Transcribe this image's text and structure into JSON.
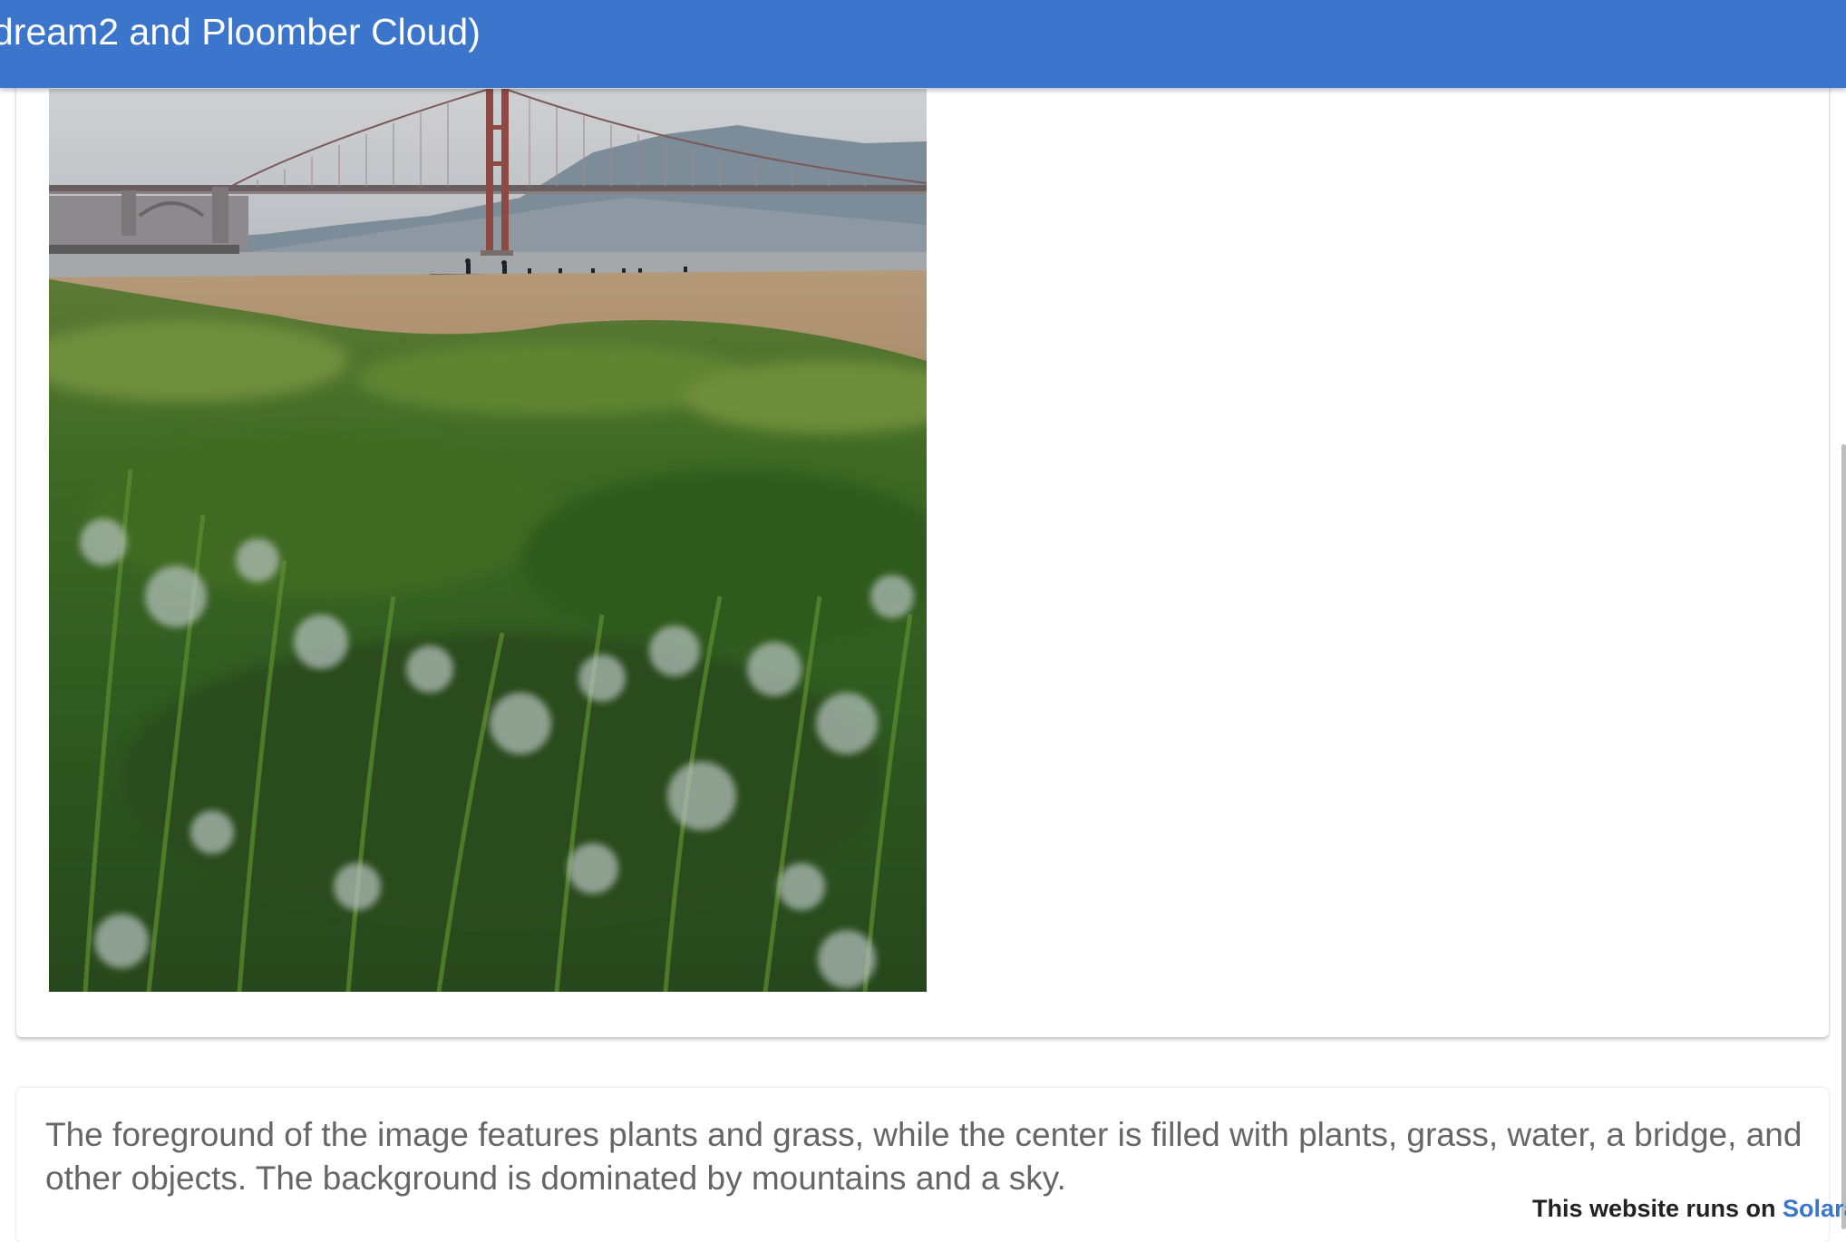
{
  "app_bar": {
    "title": "dream2 and Ploomber Cloud)",
    "color": "#3b76cc"
  },
  "image_card": {
    "photo_alt": "Golden Gate Bridge with grass in foreground"
  },
  "caption_card": {
    "text": "The foreground of the image features plants and grass, while the center is filled with plants, grass, water, a bridge, and other objects. The background is dominated by mountains and a sky."
  },
  "footer": {
    "prefix": "This website runs on ",
    "link_label": "Solara",
    "link_color": "#3b76cc"
  }
}
